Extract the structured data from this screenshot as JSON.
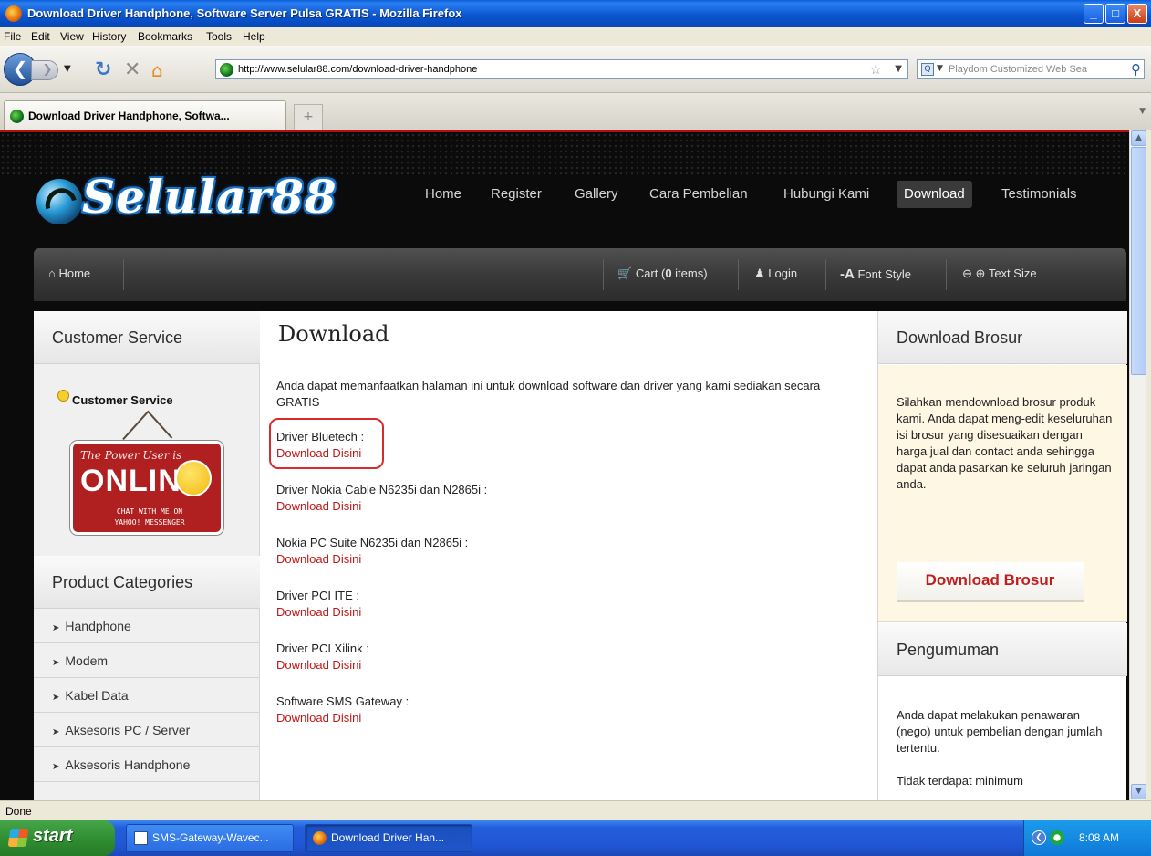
{
  "window": {
    "title": "Download Driver Handphone, Software Server Pulsa GRATIS - Mozilla Firefox",
    "minimize": "_",
    "maximize": "□",
    "close": "X"
  },
  "menu": [
    "File",
    "Edit",
    "View",
    "History",
    "Bookmarks",
    "Tools",
    "Help"
  ],
  "navigation": {
    "url": "http://www.selular88.com/download-driver-handphone",
    "search_placeholder": "Playdom Customized Web Sea"
  },
  "tabs": [
    {
      "label": "Download Driver Handphone, Softwa...",
      "active": true
    }
  ],
  "site": {
    "logo_text": "Selular88",
    "main_nav": [
      "Home",
      "Register",
      "Gallery",
      "Cara Pembelian",
      "Hubungi Kami",
      "Download",
      "Testimonials"
    ],
    "active_nav": "Download",
    "utility_bar": {
      "home": "Home",
      "cart_label": "Cart (",
      "cart_count": "0",
      "cart_suffix": " items)",
      "login": "Login",
      "font_style": "Font Style",
      "text_size": "Text Size"
    },
    "left_sidebar": {
      "customer_service_title": "Customer Service",
      "customer_service_label": "Customer Service",
      "online_sign": {
        "top": "The Power User is",
        "word": "ONLINE",
        "bottom1": "CHAT WITH ME ON",
        "bottom2": "YAHOO! MESSENGER"
      },
      "product_categories_title": "Product Categories",
      "categories": [
        "Handphone",
        "Modem",
        "Kabel Data",
        "Aksesoris PC / Server",
        "Aksesoris Handphone"
      ]
    },
    "main": {
      "title": "Download",
      "intro": "Anda dapat memanfaatkan halaman ini untuk download software dan driver yang kami sediakan secara GRATIS",
      "downloads": [
        {
          "name": "Driver Bluetech :",
          "link": "Download Disini"
        },
        {
          "name": "Driver Nokia Cable N6235i dan N2865i :",
          "link": "Download Disini"
        },
        {
          "name": "Nokia PC Suite N6235i dan N2865i :",
          "link": "Download Disini"
        },
        {
          "name": "Driver PCI ITE :",
          "link": "Download Disini"
        },
        {
          "name": "Driver PCI Xilink :",
          "link": "Download Disini"
        },
        {
          "name": "Software SMS Gateway :",
          "link": "Download Disini"
        }
      ]
    },
    "right_sidebar": {
      "brosur_title": "Download Brosur",
      "brosur_text": "Silahkan mendownload brosur produk kami. Anda dapat meng-edit keseluruhan isi brosur yang disesuaikan dengan harga jual dan contact anda sehingga dapat anda pasarkan ke seluruh jaringan anda.",
      "brosur_button": "Download Brosur",
      "pengumuman_title": "Pengumuman",
      "pengumuman_text": "Anda dapat melakukan penawaran (nego) untuk pembelian dengan jumlah tertentu.",
      "pengumuman_text2": "Tidak terdapat minimum"
    }
  },
  "status": "Done",
  "taskbar": {
    "start": "start",
    "items": [
      "SMS-Gateway-Wavec...",
      "Download Driver Han..."
    ],
    "time": "8:08 AM"
  },
  "colors": {
    "link_red": "#c01818",
    "site_bg": "#0b0b0b",
    "xp_blue": "#245edb"
  }
}
